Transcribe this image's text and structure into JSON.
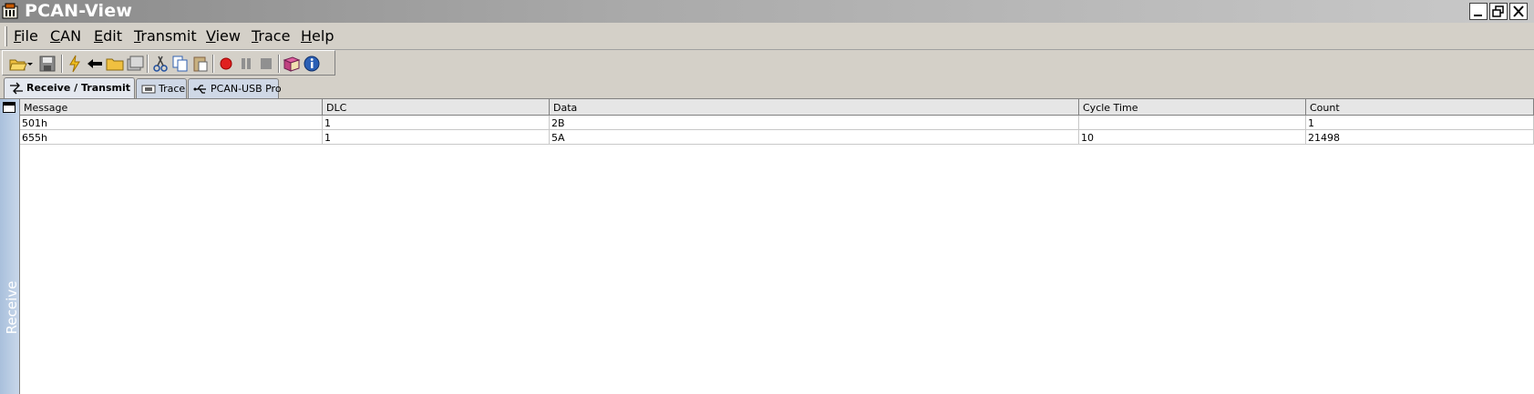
{
  "window": {
    "title": "PCAN-View"
  },
  "menu": {
    "items": [
      {
        "label": "File",
        "key": "F",
        "rest": "ile"
      },
      {
        "label": "CAN",
        "key": "C",
        "rest": "AN"
      },
      {
        "label": "Edit",
        "key": "E",
        "rest": "dit"
      },
      {
        "label": "Transmit",
        "key": "T",
        "rest": "ransmit"
      },
      {
        "label": "View",
        "key": "V",
        "rest": "iew"
      },
      {
        "label": "Trace",
        "key": "T",
        "rest": "race"
      },
      {
        "label": "Help",
        "key": "H",
        "rest": "elp"
      }
    ]
  },
  "toolbar": {
    "icons": [
      "open-folder-icon",
      "save-icon",
      "connect-icon",
      "disconnect-icon",
      "folder-icon",
      "settings-icon",
      "cut-icon",
      "copy-icon",
      "paste-icon",
      "record-icon",
      "pause-icon",
      "stop-icon",
      "book-icon",
      "info-icon"
    ]
  },
  "tabs": [
    {
      "label": "Receive / Transmit",
      "icon": "receive-transmit-icon",
      "active": true
    },
    {
      "label": "Trace",
      "icon": "trace-icon",
      "active": false
    },
    {
      "label": "PCAN-USB Pro",
      "icon": "usb-icon",
      "active": false
    }
  ],
  "side_panel": {
    "label": "Receive"
  },
  "table": {
    "columns": [
      "Message",
      "DLC",
      "Data",
      "Cycle Time",
      "Count"
    ],
    "rows": [
      [
        "501h",
        "1",
        "2B",
        "",
        "1"
      ],
      [
        "655h",
        "1",
        "5A",
        "10",
        "21498"
      ]
    ]
  },
  "colors": {
    "accent": "#a9c0dc",
    "record": "#e02020",
    "info": "#2a5fb5"
  }
}
